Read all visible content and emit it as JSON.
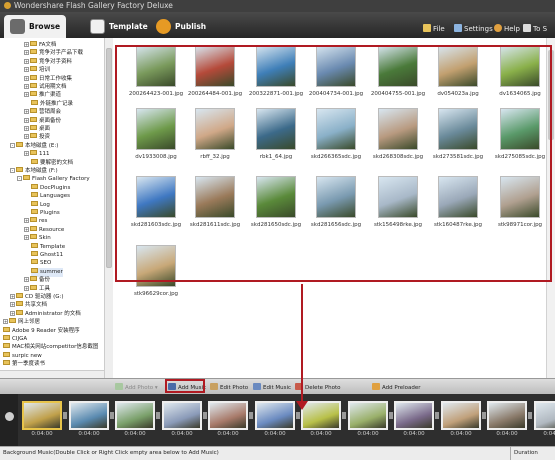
{
  "window": {
    "title": "Wondershare Flash Gallery Factory Deluxe"
  },
  "tabs": [
    {
      "label": "Browse",
      "icon": "browse-icon",
      "active": true
    },
    {
      "label": "Template",
      "icon": "template-icon",
      "active": false
    },
    {
      "label": "Publish",
      "icon": "publish-icon",
      "active": false
    }
  ],
  "menu": [
    {
      "label": "File",
      "icon": "file-icon"
    },
    {
      "label": "Settings",
      "icon": "settings-icon"
    },
    {
      "label": "Help",
      "icon": "help-icon"
    },
    {
      "label": "To S",
      "icon": "to-s-icon"
    }
  ],
  "tree": [
    {
      "label": "FA文档",
      "expand": "+"
    },
    {
      "label": "竞争对手产品下载",
      "expand": "+"
    },
    {
      "label": "竞争对手资料",
      "expand": "+"
    },
    {
      "label": "培训",
      "expand": "+"
    },
    {
      "label": "日常工作收集",
      "expand": "+"
    },
    {
      "label": "试用期文档",
      "expand": "+"
    },
    {
      "label": "推广渠道",
      "expand": "+"
    },
    {
      "label": "外链推广记录",
      "expand": ""
    },
    {
      "label": "营销周会",
      "expand": "+"
    },
    {
      "label": "桌面备份",
      "expand": "+"
    },
    {
      "label": "桌面",
      "expand": "+"
    },
    {
      "label": "投资",
      "expand": "+"
    },
    {
      "label": "本地磁盘 (E:)",
      "expand": "-"
    },
    {
      "label": "111",
      "expand": "+"
    },
    {
      "label": "要解密的文档",
      "expand": ""
    },
    {
      "label": "本地磁盘 (F:)",
      "expand": "-"
    },
    {
      "label": "Flash Gallery Factory",
      "expand": "-"
    },
    {
      "label": "DocPlugins",
      "expand": ""
    },
    {
      "label": "Languages",
      "expand": ""
    },
    {
      "label": "Log",
      "expand": ""
    },
    {
      "label": "Plugins",
      "expand": ""
    },
    {
      "label": "res",
      "expand": "+"
    },
    {
      "label": "Resource",
      "expand": "+"
    },
    {
      "label": "Skin",
      "expand": "+"
    },
    {
      "label": "Template",
      "expand": ""
    },
    {
      "label": "Ghost11",
      "expand": ""
    },
    {
      "label": "SEO",
      "expand": ""
    },
    {
      "label": "summer",
      "expand": ""
    },
    {
      "label": "备份",
      "expand": "+"
    },
    {
      "label": "工具",
      "expand": "+"
    },
    {
      "label": "CD 驱动器 (G:)",
      "expand": "+"
    },
    {
      "label": "共享文档",
      "expand": "+"
    },
    {
      "label": "Administrator 的文档",
      "expand": "+"
    },
    {
      "label": "网上邻居",
      "expand": "+"
    },
    {
      "label": "Adobe 9 Reader 安装程序",
      "expand": ""
    },
    {
      "label": "CIJGA",
      "expand": ""
    },
    {
      "label": "MAC相关网站competitor信息截图",
      "expand": ""
    },
    {
      "label": "surpic new",
      "expand": ""
    },
    {
      "label": "第一季度读书",
      "expand": ""
    }
  ],
  "photos": [
    "200264423-001.jpg",
    "200264484-001.jpg",
    "200322871-001.jpg",
    "200404734-001.jpg",
    "200404755-001.jpg",
    "dv054023a.jpg",
    "dv1634065.jpg",
    "dv1933008.jpg",
    "rbff_32.jpg",
    "rbk1_64.jpg",
    "skd266365sdc.jpg",
    "skd268308sdc.jpg",
    "skd273581sdc.jpg",
    "skd275085sdc.jpg",
    "skd281603sdc.jpg",
    "skd281611sdc.jpg",
    "skd281650sdc.jpg",
    "skd281656sdc.jpg",
    "stk156498rke.jpg",
    "stk160487rke.jpg",
    "stk98971cor.jpg",
    "stk96629cor.jpg"
  ],
  "photo_colors": [
    "#7a9a5c",
    "#b54a3a",
    "#3f7fb8",
    "#6a8ab0",
    "#4a7a3a",
    "#c2a070",
    "#8ab04a",
    "#6e9a4a",
    "#d0a888",
    "#3c6a8a",
    "#8ab0c8",
    "#b89a80",
    "#6a8a9a",
    "#5a9a6a",
    "#3f78c2",
    "#9a7a5a",
    "#5a8a3a",
    "#7a9ab0",
    "#a8b8c8",
    "#9aa8b8",
    "#b0a090",
    "#c8a878"
  ],
  "actions": [
    {
      "label": "Add Photo",
      "icon": "add-photo-icon",
      "disabled": true,
      "dropdown": true
    },
    {
      "label": "Add Music",
      "icon": "add-music-icon",
      "disabled": false
    },
    {
      "label": "Edit Photo",
      "icon": "edit-photo-icon",
      "disabled": false
    },
    {
      "label": "Edit Music",
      "icon": "edit-music-icon",
      "disabled": false
    },
    {
      "label": "Delete Photo",
      "icon": "delete-photo-icon",
      "disabled": false
    },
    {
      "label": "Add Preloader",
      "icon": "add-preloader-icon",
      "disabled": false
    }
  ],
  "filmstrip": [
    {
      "duration": "0:04:00",
      "selected": true
    },
    {
      "duration": "0:04:00"
    },
    {
      "duration": "0:04:00"
    },
    {
      "duration": "0:04:00"
    },
    {
      "duration": "0:04:00"
    },
    {
      "duration": "0:04:00"
    },
    {
      "duration": "0:04:00"
    },
    {
      "duration": "0:04:00"
    },
    {
      "duration": "0:04:00"
    },
    {
      "duration": "0:04:00"
    },
    {
      "duration": "0:04:00"
    },
    {
      "duration": "0:04:00"
    }
  ],
  "film_colors": [
    "#c0a04a",
    "#5a8ab0",
    "#7aa06a",
    "#8a9ab8",
    "#a87a6a",
    "#6a8ac0",
    "#b8c048",
    "#9ab06a",
    "#7a6a8a",
    "#c0a07a",
    "#8a7a6a",
    "#b0b8c0"
  ],
  "music_bar": {
    "text": "Background Music(Double Click or Right Click empty area below to Add Music)",
    "duration_label": "Duration"
  },
  "colors": {
    "highlight": "#b01a22",
    "toolbar": "#2e2e2e"
  }
}
